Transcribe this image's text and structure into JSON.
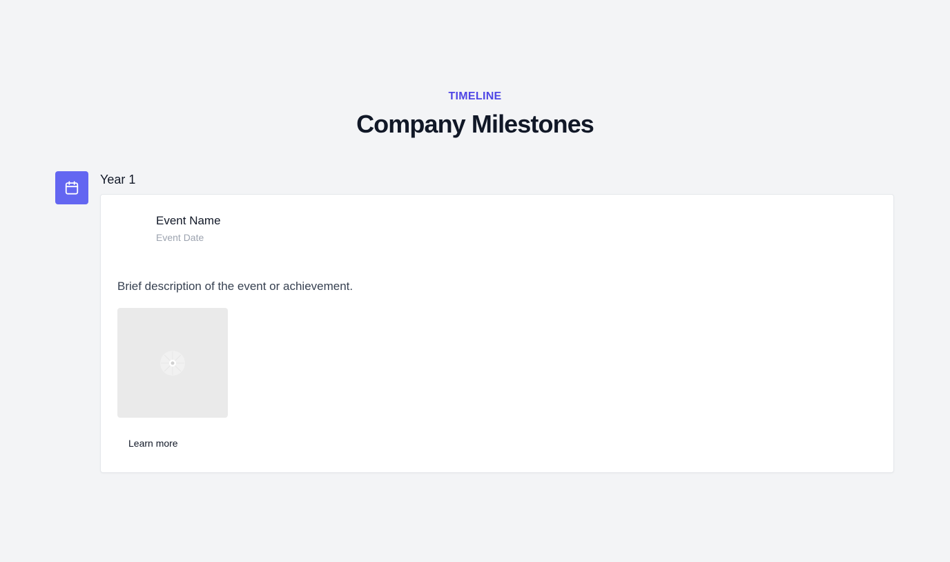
{
  "header": {
    "eyebrow": "TIMELINE",
    "title": "Company Milestones"
  },
  "timeline": {
    "items": [
      {
        "icon": "calendar-icon",
        "year_label": "Year 1",
        "event": {
          "name": "Event Name",
          "date": "Event Date",
          "description": "Brief description of the event or achievement.",
          "image_icon": "image-placeholder-icon",
          "link_label": "Learn more"
        }
      }
    ]
  },
  "colors": {
    "accent": "#4f46e5",
    "icon_background": "#6366f1",
    "page_background": "#f3f4f6",
    "card_background": "#ffffff"
  }
}
